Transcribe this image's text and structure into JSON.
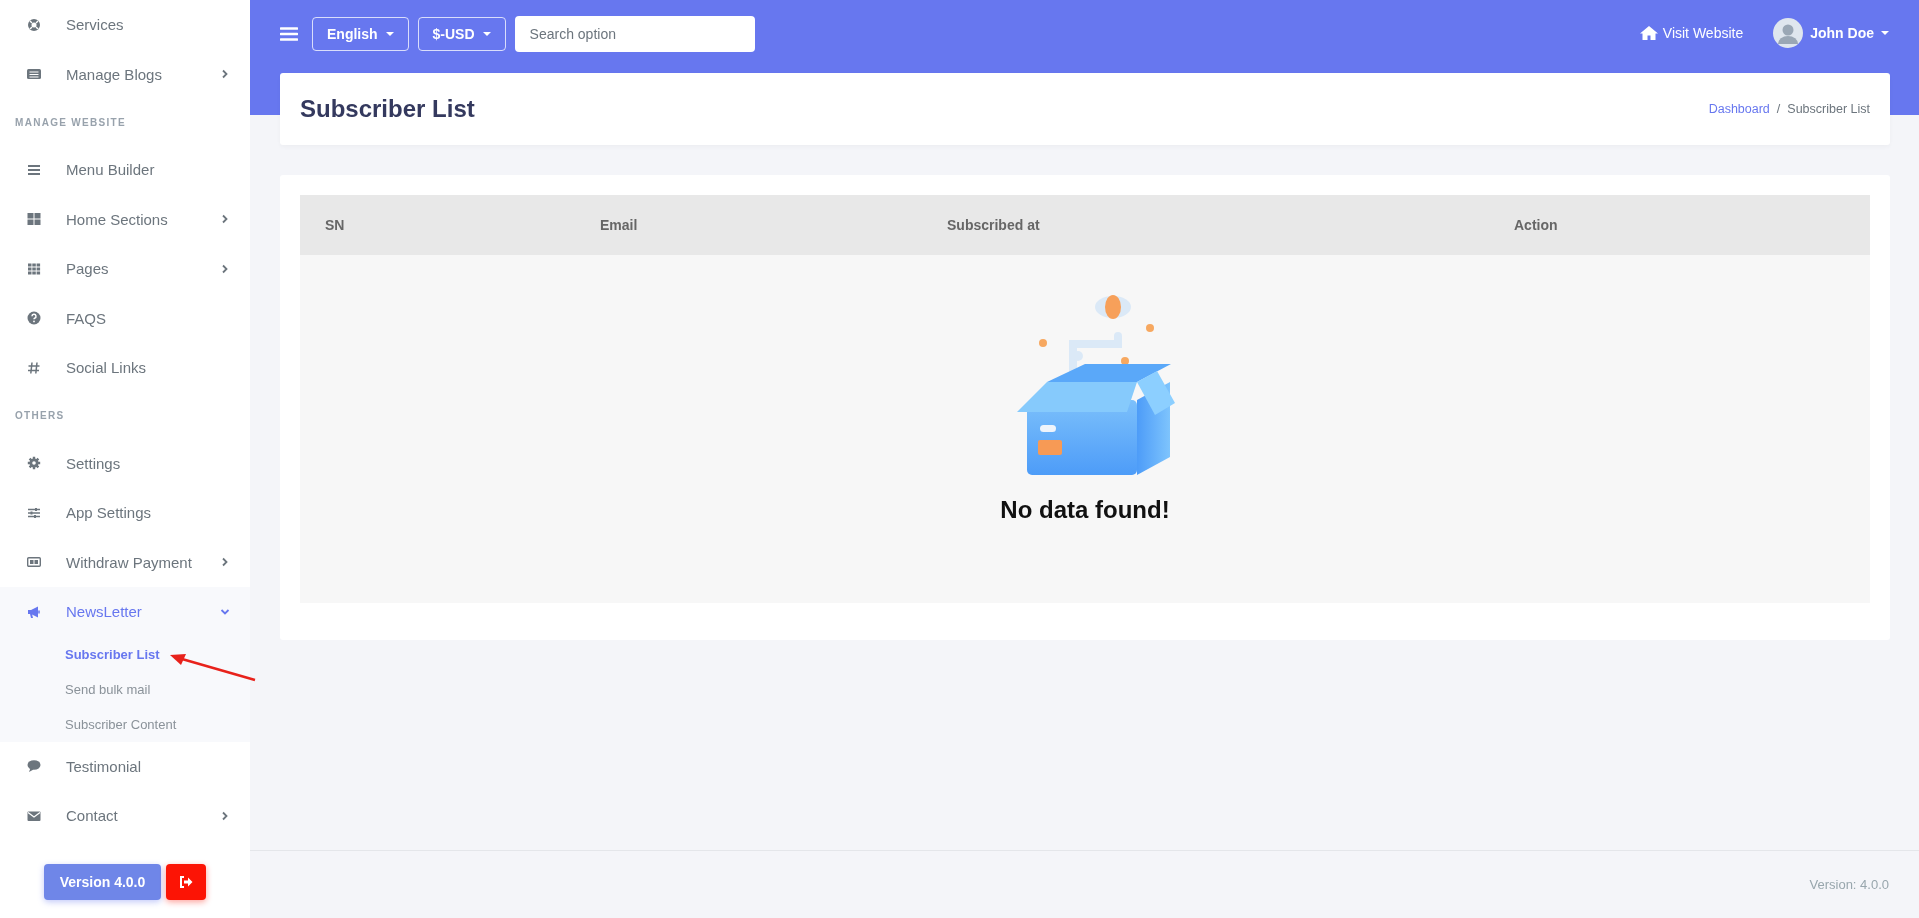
{
  "sidebar": {
    "groups": [
      {
        "items": [
          {
            "label": "Services",
            "kind": "link",
            "selected": false
          },
          {
            "label": "Manage Blogs",
            "kind": "dropdown",
            "expanded": false,
            "selected": false
          }
        ]
      },
      {
        "title": "MANAGE WEBSITE",
        "items": [
          {
            "label": "Menu Builder",
            "kind": "link",
            "selected": false
          },
          {
            "label": "Home Sections",
            "kind": "dropdown",
            "expanded": false,
            "selected": false
          },
          {
            "label": "Pages",
            "kind": "dropdown",
            "expanded": false,
            "selected": false
          },
          {
            "label": "FAQS",
            "kind": "link",
            "selected": false
          },
          {
            "label": "Social Links",
            "kind": "link",
            "selected": false
          }
        ]
      },
      {
        "title": "OTHERS",
        "items": [
          {
            "label": "Settings",
            "kind": "link",
            "selected": false
          },
          {
            "label": "App Settings",
            "kind": "link",
            "selected": false
          },
          {
            "label": "Withdraw Payment",
            "kind": "dropdown",
            "expanded": false,
            "selected": false
          },
          {
            "label": "NewsLetter",
            "kind": "dropdown",
            "expanded": true,
            "selected": true,
            "children": [
              {
                "label": "Subscriber List",
                "selected": true
              },
              {
                "label": "Send bulk mail",
                "selected": false
              },
              {
                "label": "Subscriber Content",
                "selected": false
              }
            ]
          },
          {
            "label": "Testimonial",
            "kind": "link",
            "selected": false
          },
          {
            "label": "Contact",
            "kind": "dropdown",
            "expanded": false,
            "selected": false
          }
        ]
      }
    ],
    "version_button": "Version 4.0.0"
  },
  "navbar": {
    "language": "English",
    "currency": "$-USD",
    "search": {
      "placeholder": "Search option"
    },
    "visit_link": "Visit Website",
    "user": "John Doe"
  },
  "page_header": {
    "title": "Subscriber List",
    "breadcrumb": {
      "separator": "/",
      "items": [
        {
          "label": "Dashboard",
          "kind": "link"
        },
        {
          "label": "Subscriber List",
          "kind": "current"
        }
      ]
    }
  },
  "table": {
    "columns": [
      "SN",
      "Email",
      "Subscribed at",
      "Action"
    ],
    "empty_message": "No data found!"
  },
  "footer": {
    "version": "Version: 4.0.0"
  }
}
